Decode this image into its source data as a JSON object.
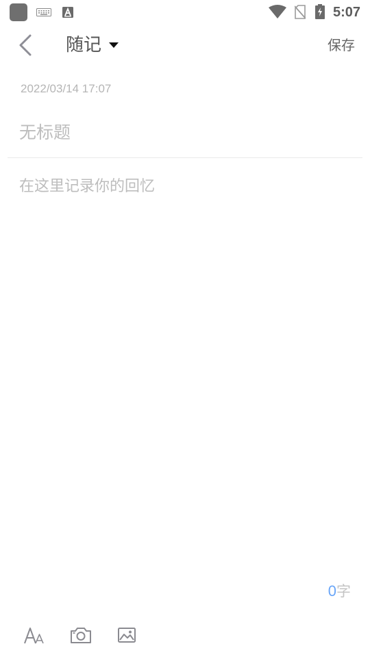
{
  "status_bar": {
    "time": "5:07",
    "icons": [
      "app-icon",
      "keyboard-icon",
      "a-notification-icon",
      "wifi-icon",
      "no-sim-icon",
      "battery-charging-icon"
    ]
  },
  "header": {
    "back_icon": "chevron-left-icon",
    "title": "随记",
    "dropdown_icon": "caret-down-icon",
    "save_label": "保存"
  },
  "note": {
    "date": "2022/03/14 17:07",
    "title_value": "",
    "title_placeholder": "无标题",
    "body_value": "",
    "body_placeholder": "在这里记录你的回忆"
  },
  "word_count": {
    "count": "0",
    "unit": "字"
  },
  "toolbar": {
    "tools": [
      "font-size-icon",
      "camera-icon",
      "image-icon"
    ]
  },
  "colors": {
    "accent": "#6aa6f8",
    "placeholder": "#bdbdbd",
    "divider": "#e9e9e9"
  }
}
